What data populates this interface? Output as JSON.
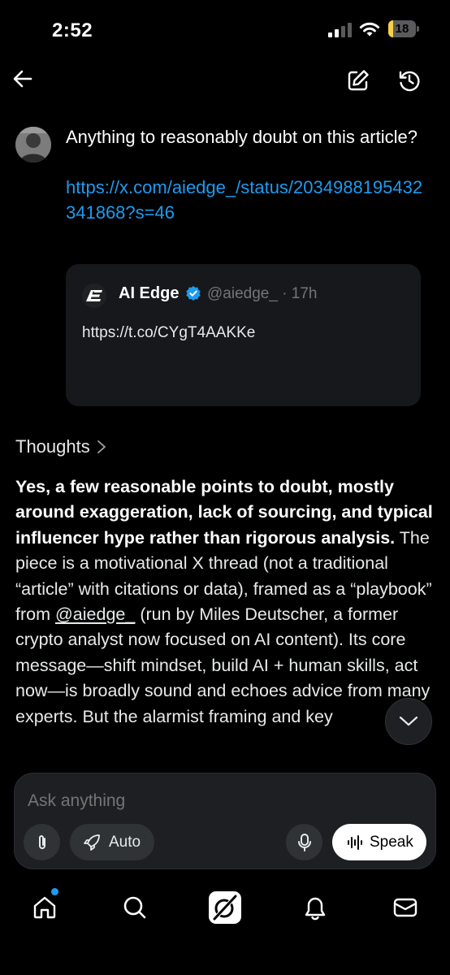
{
  "status_bar": {
    "time": "2:52",
    "battery": "18",
    "battery_level": 0.18,
    "battery_color": "#f7d047"
  },
  "nav": {
    "back_icon": "arrow-left-icon",
    "new_chat_icon": "edit-icon",
    "history_icon": "history-icon"
  },
  "user_message": {
    "text": "Anything to reasonably doubt on this article?",
    "link": "https://x.com/aiedge_/status/2034988195432341868?s=46"
  },
  "quoted_post": {
    "name": "AI Edge",
    "handle": "@aiedge_ · 17h",
    "link": "https://t.co/CYgT4AAKKe"
  },
  "thoughts_label": "Thoughts",
  "answer": {
    "bold": "Yes, a few reasonable points to doubt, mostly around exaggeration, lack of sourcing, and typical influencer hype rather than rigorous analysis.",
    "text_before_mention": " The piece is a motivational X thread (not a traditional “article” with citations or data), framed as a “playbook” from ",
    "mention": "@aiedge_",
    "text_after_mention": "  (run by Miles Deutscher, a former crypto analyst now focused on AI content). Its core message—shift mindset, build AI + human skills, act now—is broadly sound and echoes advice from many experts. But the alarmist framing and key"
  },
  "composer": {
    "placeholder": "Ask anything",
    "mode_label": "Auto",
    "speak_label": "Speak"
  },
  "tab_bar": {
    "items": [
      "home-icon",
      "search-icon",
      "grok-icon",
      "notifications-icon",
      "messages-icon"
    ]
  },
  "colors": {
    "accent": "#1d9bf0",
    "verified": "#1d9bf0"
  }
}
